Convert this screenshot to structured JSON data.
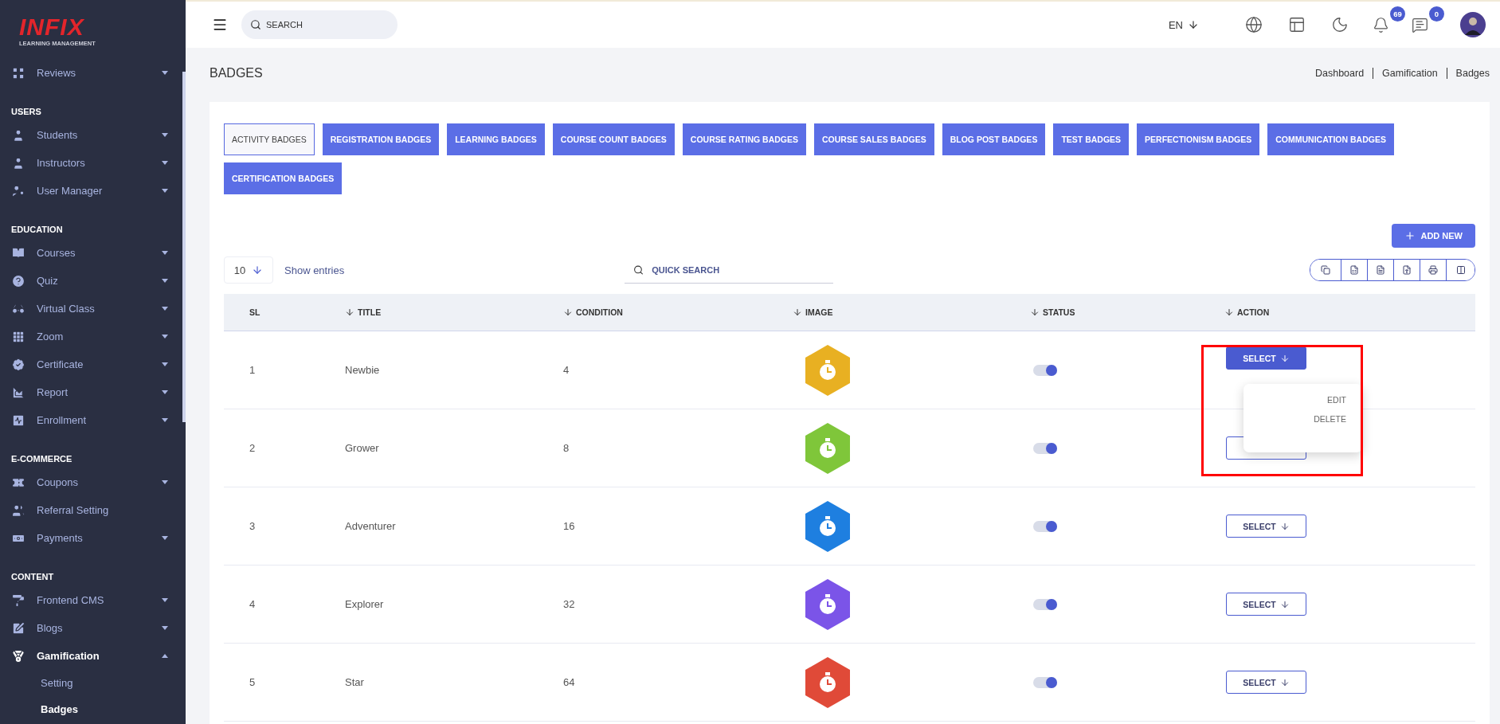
{
  "sidebar": {
    "logo": {
      "name": "INFIX",
      "tagline": "LEARNING MANAGEMENT"
    },
    "sections": [
      {
        "items": [
          {
            "label": "Reviews",
            "kind": "menu",
            "expanded": false,
            "selected": false
          }
        ]
      },
      {
        "heading": "USERS",
        "items": [
          {
            "label": "Students",
            "kind": "menu",
            "expanded": false,
            "selected": false
          },
          {
            "label": "Instructors",
            "kind": "menu",
            "expanded": false,
            "selected": false
          },
          {
            "label": "User Manager",
            "kind": "menu",
            "expanded": false,
            "selected": false
          }
        ]
      },
      {
        "heading": "EDUCATION",
        "items": [
          {
            "label": "Courses",
            "kind": "menu",
            "expanded": false,
            "selected": false
          },
          {
            "label": "Quiz",
            "kind": "menu",
            "expanded": false,
            "selected": false
          },
          {
            "label": "Virtual Class",
            "kind": "menu",
            "expanded": false,
            "selected": false
          },
          {
            "label": "Zoom",
            "kind": "menu",
            "expanded": false,
            "selected": false
          },
          {
            "label": "Certificate",
            "kind": "menu",
            "expanded": false,
            "selected": false
          },
          {
            "label": "Report",
            "kind": "menu",
            "expanded": false,
            "selected": false
          },
          {
            "label": "Enrollment",
            "kind": "menu",
            "expanded": false,
            "selected": false
          }
        ]
      },
      {
        "heading": "E-COMMERCE",
        "items": [
          {
            "label": "Coupons",
            "kind": "menu",
            "expanded": false,
            "selected": false
          },
          {
            "label": "Referral Setting",
            "kind": "link",
            "selected": false
          },
          {
            "label": "Payments",
            "kind": "menu",
            "expanded": false,
            "selected": false
          }
        ]
      },
      {
        "heading": "CONTENT",
        "items": [
          {
            "label": "Frontend CMS",
            "kind": "menu",
            "expanded": false,
            "selected": false
          },
          {
            "label": "Blogs",
            "kind": "menu",
            "expanded": false,
            "selected": false
          },
          {
            "label": "Gamification",
            "kind": "menu",
            "expanded": true,
            "selected": true,
            "children": [
              {
                "label": "Setting",
                "selected": false
              },
              {
                "label": "Badges",
                "selected": true
              }
            ]
          }
        ]
      }
    ]
  },
  "header": {
    "search": {
      "placeholder": "SEARCH"
    },
    "language": "EN",
    "notifications": "69",
    "messages": "0"
  },
  "page": {
    "title": "BADGES",
    "breadcrumb": [
      "Dashboard",
      "Gamification",
      "Badges"
    ]
  },
  "tabs": [
    {
      "label": "ACTIVITY BADGES",
      "selected": true
    },
    {
      "label": "REGISTRATION BADGES",
      "selected": false
    },
    {
      "label": "LEARNING BADGES",
      "selected": false
    },
    {
      "label": "COURSE COUNT BADGES",
      "selected": false
    },
    {
      "label": "COURSE RATING BADGES",
      "selected": false
    },
    {
      "label": "COURSE SALES BADGES",
      "selected": false
    },
    {
      "label": "BLOG POST BADGES",
      "selected": false
    },
    {
      "label": "TEST BADGES",
      "selected": false
    },
    {
      "label": "PERFECTIONISM BADGES",
      "selected": false
    },
    {
      "label": "COMMUNICATION BADGES",
      "selected": false
    },
    {
      "label": "CERTIFICATION BADGES",
      "selected": false
    }
  ],
  "add_new": "ADD NEW",
  "table_controls": {
    "page_size": "10",
    "show_entries": "Show entries",
    "quick_search": {
      "placeholder": "QUICK SEARCH"
    }
  },
  "table": {
    "columns": [
      {
        "label": "SL",
        "sortable": false
      },
      {
        "label": "TITLE",
        "sortable": true
      },
      {
        "label": "CONDITION",
        "sortable": true
      },
      {
        "label": "IMAGE",
        "sortable": true
      },
      {
        "label": "STATUS",
        "sortable": true
      },
      {
        "label": "ACTION",
        "sortable": true
      }
    ],
    "rows": [
      {
        "sl": "1",
        "title": "Newbie",
        "condition": "4",
        "color": "#e8b022",
        "on": true,
        "highlighted": true,
        "action": {
          "label": "SELECT",
          "open": true,
          "menu": [
            "EDIT",
            "DELETE"
          ]
        }
      },
      {
        "sl": "2",
        "title": "Grower",
        "condition": "8",
        "color": "#7fc63a",
        "on": true,
        "highlighted": false,
        "action": {
          "open": false
        }
      },
      {
        "sl": "3",
        "title": "Adventurer",
        "condition": "16",
        "color": "#1e7fe0",
        "on": true,
        "highlighted": false,
        "action": {
          "label": "SELECT",
          "open": false
        }
      },
      {
        "sl": "4",
        "title": "Explorer",
        "condition": "32",
        "color": "#7b54e8",
        "on": true,
        "highlighted": false,
        "action": {
          "label": "SELECT",
          "open": false
        }
      },
      {
        "sl": "5",
        "title": "Star",
        "condition": "64",
        "color": "#e04a38",
        "on": true,
        "highlighted": false,
        "action": {
          "label": "SELECT",
          "open": false
        }
      }
    ]
  }
}
